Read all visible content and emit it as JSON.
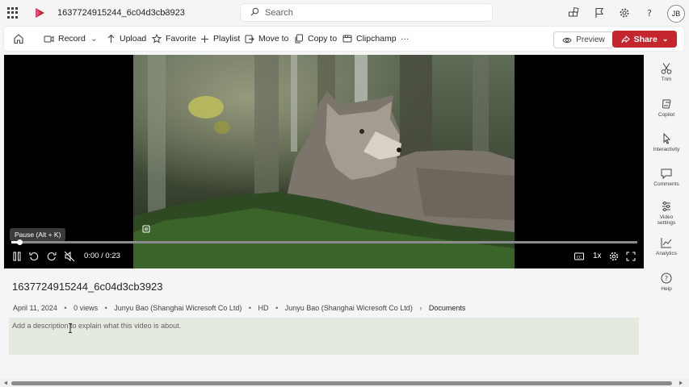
{
  "header": {
    "file_title": "1637724915244_6c04d3cb3923",
    "search_placeholder": "Search",
    "avatar_initials": "JB"
  },
  "toolbar": {
    "record_label": "Record",
    "upload_label": "Upload",
    "favorite_label": "Favorite",
    "playlist_label": "Playlist",
    "move_to_label": "Move to",
    "copy_to_label": "Copy to",
    "clipchamp_label": "Clipchamp",
    "more_label": "···",
    "preview_label": "Preview",
    "share_label": "Share"
  },
  "player": {
    "tooltip": "Pause (Alt + K)",
    "time": "0:00 / 0:23",
    "speed": "1x",
    "progress_fraction": 0.01
  },
  "rail": {
    "trim": "Trim",
    "copilot": "Copilot",
    "interactivity": "Interactivity",
    "comments": "Comments",
    "video_settings_line1": "Video",
    "video_settings_line2": "settings",
    "analytics": "Analytics",
    "help": "Help"
  },
  "details": {
    "title": "1637724915244_6c04d3cb3923",
    "date": "April 11, 2024",
    "views": "0 views",
    "owner": "Junyu Bao (Shanghai Wicresoft Co Ltd)",
    "quality": "HD",
    "location_owner": "Junyu Bao (Shanghai Wicresoft Co Ltd)",
    "location_folder": "Documents",
    "description_placeholder": "Add a description to explain what this video is about."
  },
  "colors": {
    "share_red": "#c4262e",
    "description_bg": "#e4eadf",
    "player_bg": "#000000"
  }
}
